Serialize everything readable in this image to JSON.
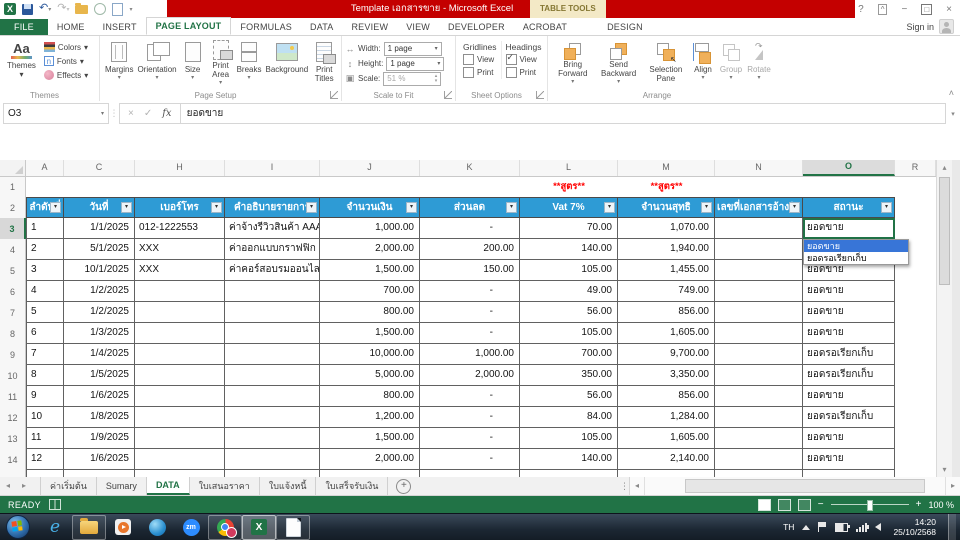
{
  "window": {
    "title": "Template เอกสารขาย - Microsoft Excel",
    "contextual_tool": "TABLE TOOLS",
    "help": "?",
    "sign_in": "Sign in"
  },
  "ribbon": {
    "tabs": [
      "FILE",
      "HOME",
      "INSERT",
      "PAGE LAYOUT",
      "FORMULAS",
      "DATA",
      "REVIEW",
      "VIEW",
      "DEVELOPER",
      "ACROBAT"
    ],
    "contextual_tab": "DESIGN",
    "active_tab": "PAGE LAYOUT",
    "groups": {
      "themes": {
        "name": "Themes",
        "themes_button": "Themes",
        "colors": "Colors",
        "fonts": "Fonts",
        "effects": "Effects"
      },
      "page_setup": {
        "name": "Page Setup",
        "margins": "Margins",
        "orientation": "Orientation",
        "size": "Size",
        "print_area": "Print Area",
        "breaks": "Breaks",
        "background": "Background",
        "print_titles": "Print Titles"
      },
      "scale_to_fit": {
        "name": "Scale to Fit",
        "width_label": "Width:",
        "width_value": "1 page",
        "height_label": "Height:",
        "height_value": "1 page",
        "scale_label": "Scale:",
        "scale_value": "51 %"
      },
      "sheet_options": {
        "name": "Sheet Options",
        "gridlines": "Gridlines",
        "headings": "Headings",
        "view": "View",
        "print": "Print",
        "gridlines_view_checked": false,
        "gridlines_print_checked": false,
        "headings_view_checked": true,
        "headings_print_checked": false
      },
      "arrange": {
        "name": "Arrange",
        "bring_forward": "Bring Forward",
        "send_backward": "Send Backward",
        "selection_pane": "Selection Pane",
        "align": "Align",
        "group": "Group",
        "rotate": "Rotate"
      }
    }
  },
  "formula_bar": {
    "name_box": "O3",
    "value": "ยอดขาย"
  },
  "grid": {
    "columns": [
      "A",
      "C",
      "H",
      "I",
      "J",
      "K",
      "L",
      "M",
      "N",
      "O",
      "R"
    ],
    "selected_column": "O",
    "selected_row": 3,
    "notes": [
      "**สูตร**",
      "**สูตร**"
    ],
    "headers": [
      "ลำดับที่",
      "วันที่",
      "เบอร์โทร",
      "คำอธิบายรายการ",
      "จำนวนเงิน",
      "ส่วนลด",
      "Vat 7%",
      "จำนวนสุทธิ",
      "เลขที่เอกสารอ้างอิง",
      "สถานะ"
    ],
    "rows": [
      {
        "n": 3,
        "cells": [
          "1",
          "1/1/2025",
          "012-1222553",
          "ค่าจ้างรีวิวสินค้า AAA",
          "1,000.00",
          "-",
          "70.00",
          "1,070.00",
          "",
          "ยอดขาย"
        ]
      },
      {
        "n": 4,
        "cells": [
          "2",
          "5/1/2025",
          "XXX",
          "ค่าออกแบบกราฟฟิก",
          "2,000.00",
          "200.00",
          "140.00",
          "1,940.00",
          "",
          ""
        ]
      },
      {
        "n": 5,
        "cells": [
          "3",
          "10/1/2025",
          "XXX",
          "ค่าคอร์สอบรมออนไลน์",
          "1,500.00",
          "150.00",
          "105.00",
          "1,455.00",
          "",
          "ยอดขาย"
        ]
      },
      {
        "n": 6,
        "cells": [
          "4",
          "1/2/2025",
          "",
          "",
          "700.00",
          "-",
          "49.00",
          "749.00",
          "",
          "ยอดขาย"
        ]
      },
      {
        "n": 7,
        "cells": [
          "5",
          "1/2/2025",
          "",
          "",
          "800.00",
          "-",
          "56.00",
          "856.00",
          "",
          "ยอดขาย"
        ]
      },
      {
        "n": 8,
        "cells": [
          "6",
          "1/3/2025",
          "",
          "",
          "1,500.00",
          "-",
          "105.00",
          "1,605.00",
          "",
          "ยอดขาย"
        ]
      },
      {
        "n": 9,
        "cells": [
          "7",
          "1/4/2025",
          "",
          "",
          "10,000.00",
          "1,000.00",
          "700.00",
          "9,700.00",
          "",
          "ยอดรอเรียกเก็บ"
        ]
      },
      {
        "n": 10,
        "cells": [
          "8",
          "1/5/2025",
          "",
          "",
          "5,000.00",
          "2,000.00",
          "350.00",
          "3,350.00",
          "",
          "ยอดรอเรียกเก็บ"
        ]
      },
      {
        "n": 11,
        "cells": [
          "9",
          "1/6/2025",
          "",
          "",
          "800.00",
          "-",
          "56.00",
          "856.00",
          "",
          "ยอดขาย"
        ]
      },
      {
        "n": 12,
        "cells": [
          "10",
          "1/8/2025",
          "",
          "",
          "1,200.00",
          "-",
          "84.00",
          "1,284.00",
          "",
          "ยอดรอเรียกเก็บ"
        ]
      },
      {
        "n": 13,
        "cells": [
          "11",
          "1/9/2025",
          "",
          "",
          "1,500.00",
          "-",
          "105.00",
          "1,605.00",
          "",
          "ยอดขาย"
        ]
      },
      {
        "n": 14,
        "cells": [
          "12",
          "1/6/2025",
          "",
          "",
          "2,000.00",
          "-",
          "140.00",
          "2,140.00",
          "",
          "ยอดขาย"
        ]
      }
    ],
    "dropdown": {
      "items": [
        "ยอดขาย",
        "ยอดรอเรียกเก็บ"
      ],
      "selected": "ยอดขาย"
    }
  },
  "sheet_tabs": {
    "tabs": [
      "ค่าเริ่มต้น",
      "Sumary",
      "DATA",
      "ใบเสนอราคา",
      "ใบแจ้งหนี้",
      "ใบเสร็จรับเงิน"
    ],
    "active": "DATA"
  },
  "status_bar": {
    "mode": "READY",
    "zoom": "100 %"
  },
  "taskbar": {
    "language": "TH",
    "time": "14:20",
    "date": "25/10/2568"
  },
  "colors": {
    "excel_green": "#217346",
    "title_red": "#c40000",
    "header_blue": "#2e9bd5",
    "selection_blue": "#3875d7"
  }
}
